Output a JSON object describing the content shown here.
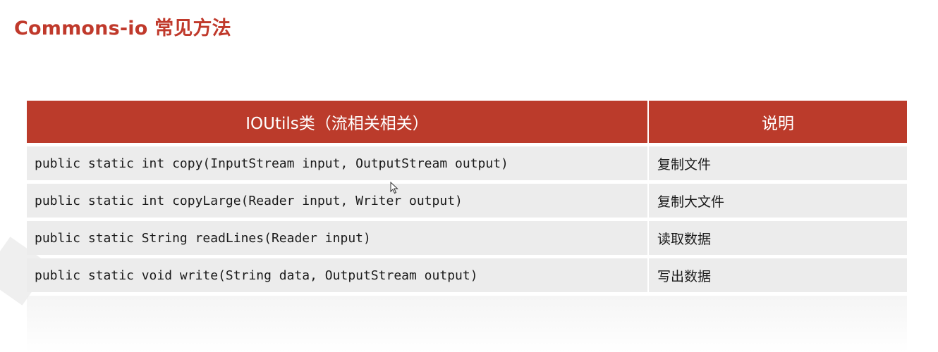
{
  "slide": {
    "title": "Commons-io 常见方法"
  },
  "table": {
    "headers": {
      "method": "IOUtils类（流相关相关）",
      "description": "说明"
    },
    "rows": [
      {
        "method": "public static int copy(InputStream input, OutputStream output)",
        "description": "复制文件"
      },
      {
        "method": "public static int copyLarge(Reader input, Writer output)",
        "description": "复制大文件"
      },
      {
        "method": "public static String readLines(Reader input)",
        "description": "读取数据"
      },
      {
        "method": "public static void write(String data, OutputStream output)",
        "description": "写出数据"
      }
    ]
  },
  "colors": {
    "accent": "#c0392b",
    "header_bg": "#bb3b2b",
    "row_bg": "#ececec"
  },
  "icons": {
    "cursor": "mouse-pointer-icon"
  }
}
